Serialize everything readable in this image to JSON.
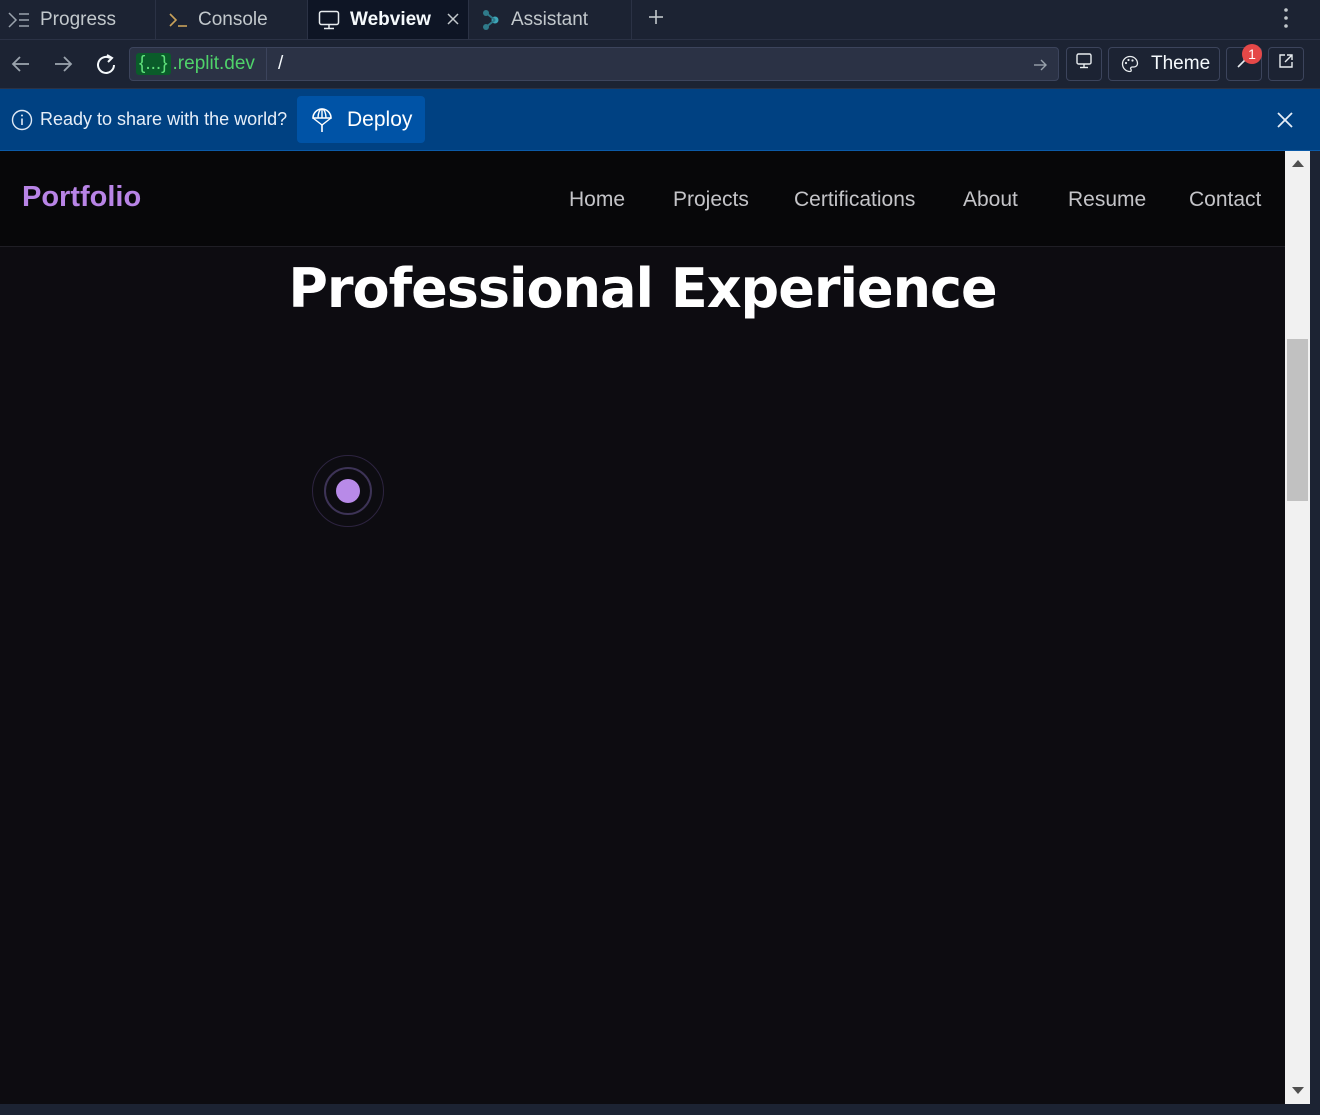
{
  "tabs": [
    {
      "label": "Progress",
      "icon": "progress-icon"
    },
    {
      "label": "Console",
      "icon": "console-icon"
    },
    {
      "label": "Webview",
      "icon": "monitor-icon",
      "active": true
    },
    {
      "label": "Assistant",
      "icon": "assistant-icon"
    }
  ],
  "url": {
    "domain_prefix": "{...}",
    "domain_suffix": ".replit.dev",
    "path": "/"
  },
  "toolbar": {
    "theme_label": "Theme",
    "notification_count": "1"
  },
  "banner": {
    "message": "Ready to share with the world?",
    "deploy_label": "Deploy"
  },
  "site": {
    "brand": "Portfolio",
    "nav": [
      "Home",
      "Projects",
      "Certifications",
      "About",
      "Resume",
      "Contact"
    ],
    "heading": "Professional Experience"
  },
  "colors": {
    "brand_purple": "#b884e6",
    "banner_blue": "#004182",
    "page_bg": "#0d0c11"
  }
}
